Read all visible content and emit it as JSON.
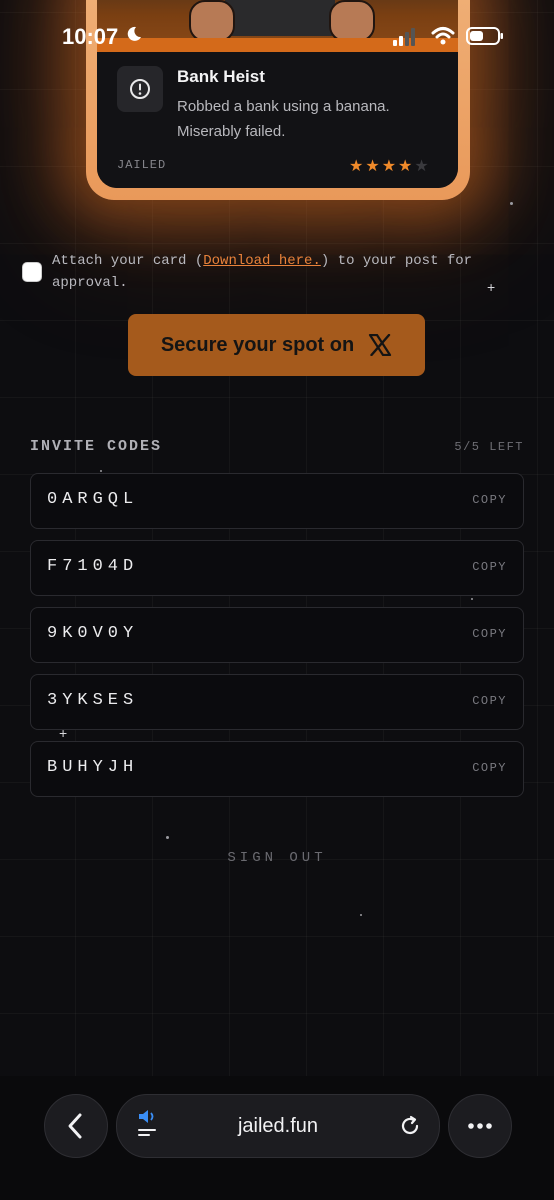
{
  "status_bar": {
    "time": "10:07"
  },
  "card": {
    "title": "Bank Heist",
    "description": "Robbed a bank using a banana. Miserably failed.",
    "status": "JAILED",
    "rating": 4,
    "rating_max": 5,
    "accent": "#f08a2a"
  },
  "attach": {
    "text_before": "Attach your card (",
    "link_text": "Download here.",
    "text_after": ") to your post for approval."
  },
  "cta": {
    "label": "Secure your spot on",
    "icon": "x-logo-icon",
    "color": "#a55a1c"
  },
  "invite": {
    "title": "INVITE CODES",
    "remaining": "5/5 LEFT",
    "copy_label": "COPY",
    "codes": [
      "0ARGQL",
      "F7104D",
      "9K0V0Y",
      "3YKSES",
      "BUHYJH"
    ]
  },
  "signout": "SIGN OUT",
  "browser": {
    "url": "jailed.fun"
  }
}
